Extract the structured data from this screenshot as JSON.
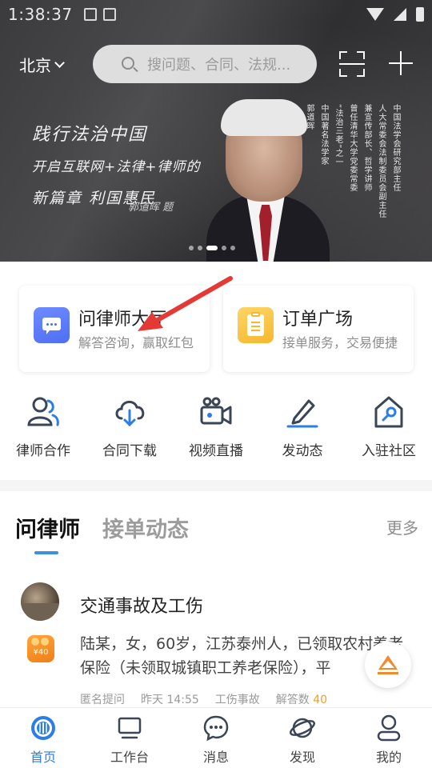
{
  "status_bar": {
    "time": "1:38:37"
  },
  "header": {
    "city": "北京",
    "search_placeholder": "搜问题、合同、法规..."
  },
  "banner": {
    "calligraphy_line1": "践行法治中国",
    "calligraphy_line2": "开启互联网+法律+律师的",
    "calligraphy_line3": "新篇章 利国惠民",
    "signature": "郭道晖 题",
    "vertical_text": [
      "中国法学会研究部主任",
      "人大常委会法制委员会副主任",
      "兼宣传部长、哲学讲师",
      "曾任清华大学党委常委",
      "“法治三老”之一",
      "中国著名法学家",
      "郭道晖"
    ],
    "slide_count": 5,
    "active_slide": 3
  },
  "cards": [
    {
      "title": "问律师大厅",
      "subtitle": "解答咨询，赢取红包"
    },
    {
      "title": "订单广场",
      "subtitle": "接单服务，交易便捷"
    }
  ],
  "quick_actions": [
    {
      "label": "律师合作",
      "icon": "users-icon"
    },
    {
      "label": "合同下载",
      "icon": "cloud-download-icon"
    },
    {
      "label": "视频直播",
      "icon": "video-camera-icon"
    },
    {
      "label": "发动态",
      "icon": "pencil-icon"
    },
    {
      "label": "入驻社区",
      "icon": "house-key-icon"
    }
  ],
  "tabs": {
    "active": "问律师",
    "inactive": "接单动态",
    "more": "更多"
  },
  "question": {
    "title": "交通事故及工伤",
    "reward": "¥40",
    "body": "陆某，女，60岁，江苏泰州人，已领取农村养老保险（未领取城镇职工养老保险），平",
    "asker": "匿名提问",
    "time": "昨天 14:55",
    "category": "工伤事故",
    "answers_label": "解答数",
    "answers_count": "40"
  },
  "bottom_nav": [
    {
      "label": "首页",
      "icon": "home-logo-icon",
      "active": true
    },
    {
      "label": "工作台",
      "icon": "monitor-icon",
      "active": false
    },
    {
      "label": "消息",
      "icon": "chat-bubble-icon",
      "active": false
    },
    {
      "label": "发现",
      "icon": "planet-icon",
      "active": false
    },
    {
      "label": "我的",
      "icon": "person-icon",
      "active": false
    }
  ],
  "colors": {
    "accent": "#2b7de9",
    "orange": "#f08a2c",
    "card_blue": "#5b7bf7",
    "card_yellow": "#f7c23f"
  }
}
